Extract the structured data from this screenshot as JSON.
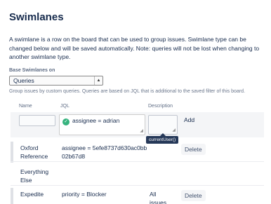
{
  "page": {
    "title": "Swimlanes",
    "description": "A swimlane is a row on the board that can be used to group issues. Swimlane type can be changed below and will be saved automatically. Note: queries will not be lost when changing to another swimlane type."
  },
  "base": {
    "label": "Base Swimlanes on",
    "selected": "Queries",
    "help": "Group issues by custom queries. Queries are based on JQL that is additional to the saved filter of this board."
  },
  "table": {
    "headers": {
      "name": "Name",
      "jql": "JQL",
      "description": "Description"
    },
    "add_row": {
      "name_value": "",
      "jql_value": "assignee = adrian",
      "description_value": "",
      "add_label": "Add",
      "tooltip": "currentUser()",
      "valid_icon": "check-circle-icon"
    },
    "rows": [
      {
        "name": "Oxford Reference",
        "jql": "assignee = 5efe8737d630ac0bb02b67d8",
        "description": "",
        "action": "Delete"
      },
      {
        "name": "Everything Else",
        "jql": "",
        "description": "",
        "action": ""
      },
      {
        "name": "Expedite",
        "jql": "priority = Blocker",
        "description": "All issues",
        "action": "Delete"
      }
    ]
  },
  "colors": {
    "valid": "#36b37e",
    "tooltip_bg": "#253858"
  }
}
